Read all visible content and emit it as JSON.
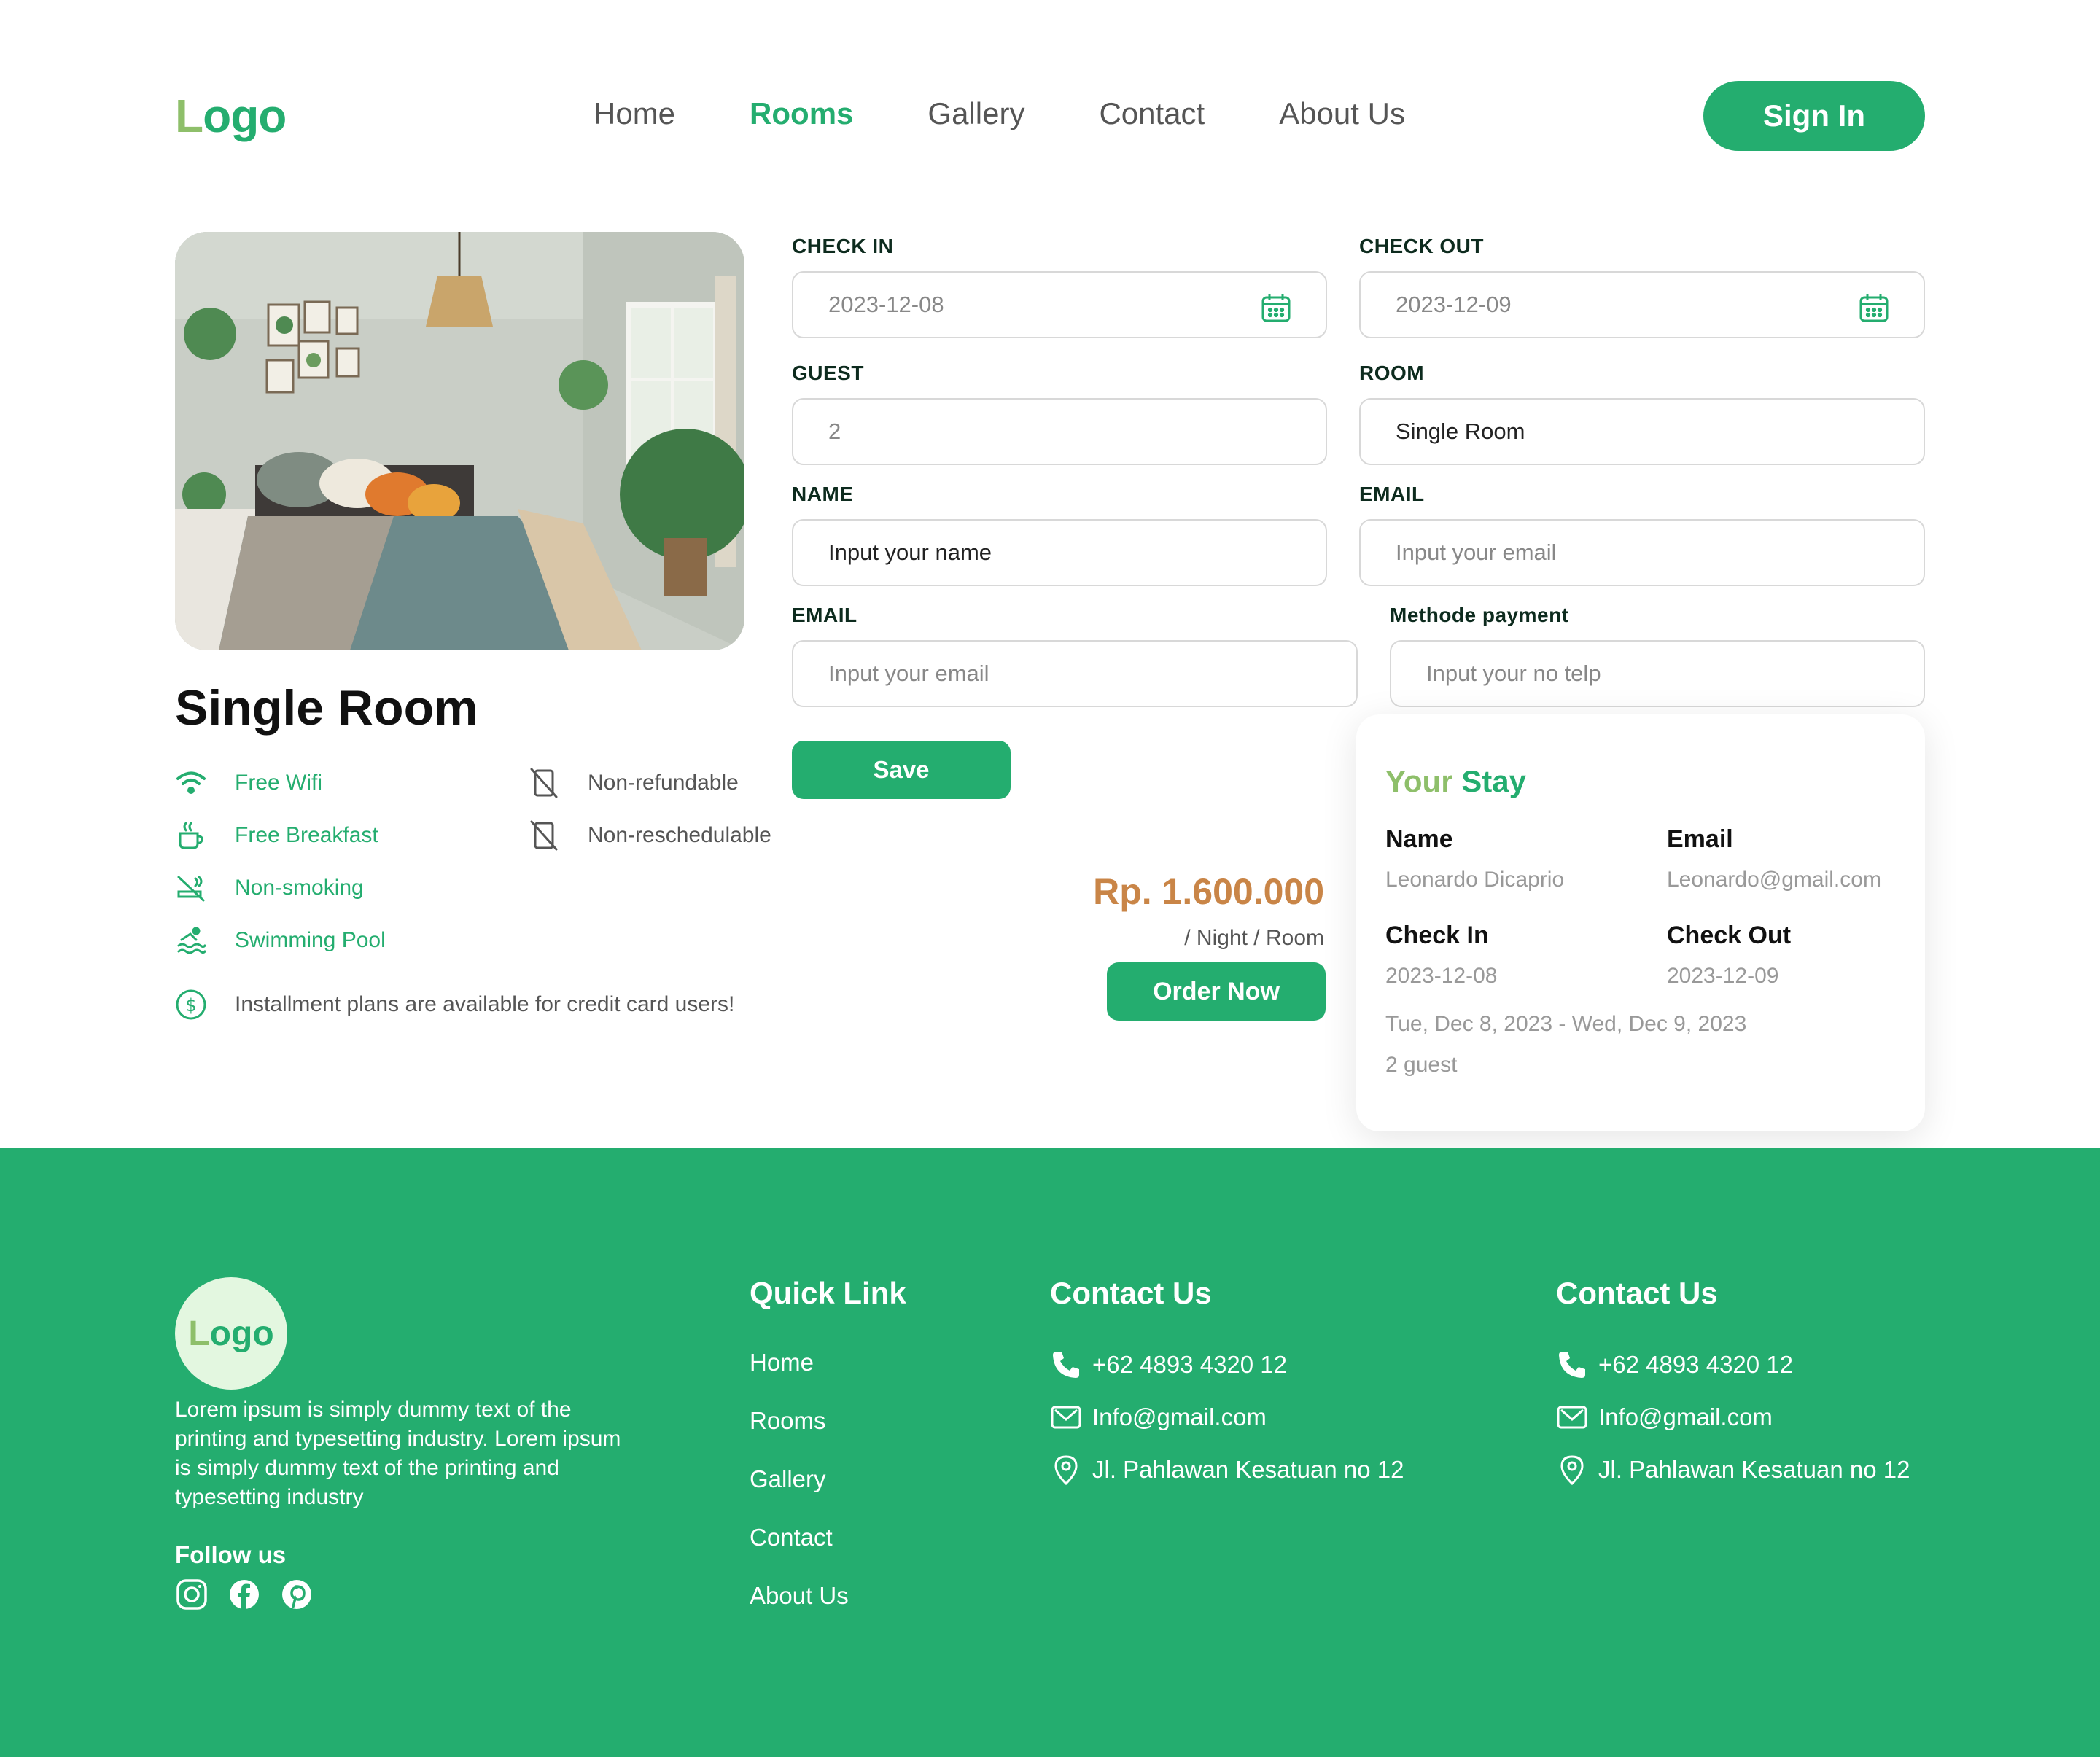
{
  "header": {
    "logo": "Logo",
    "nav": [
      "Home",
      "Rooms",
      "Gallery",
      "Contact",
      "About Us"
    ],
    "active_nav": "Rooms",
    "signin_label": "Sign In"
  },
  "room": {
    "title": "Single Room",
    "features": [
      {
        "label": "Free Wifi",
        "icon": "wifi-icon"
      },
      {
        "label": "Free Breakfast",
        "icon": "coffee-icon"
      },
      {
        "label": "Non-smoking",
        "icon": "no-smoking-icon"
      },
      {
        "label": "Swimming Pool",
        "icon": "swimming-icon"
      }
    ],
    "policies": [
      {
        "label": "Non-refundable",
        "icon": "no-phone-icon"
      },
      {
        "label": "Non-reschedulable",
        "icon": "no-phone-icon"
      }
    ],
    "installment_note": "Installment plans are available for credit card users!"
  },
  "form": {
    "checkin_label": "CHECK IN",
    "checkin_value": "2023-12-08",
    "checkout_label": "CHECK OUT",
    "checkout_value": "2023-12-09",
    "guest_label": "GUEST",
    "guest_value": "2",
    "room_label": "ROOM",
    "room_value": "Single Room",
    "name_label": "NAME",
    "name_placeholder": "Input your name",
    "email_label": "EMAIL",
    "email_placeholder": "Input your email",
    "email2_label": "EMAIL",
    "email2_placeholder": "Input your email",
    "payment_label": "Methode payment",
    "payment_placeholder": "Input your no telp",
    "save_label": "Save"
  },
  "pricing": {
    "price": "Rp. 1.600.000",
    "per": "/  Night /  Room",
    "order_label": "Order Now"
  },
  "stay": {
    "title_part1": "Your",
    "title_part2": " Stay",
    "name_label": "Name",
    "name_value": "Leonardo Dicaprio",
    "email_label": "Email",
    "email_value": "Leonardo@gmail.com",
    "checkin_label": "Check In",
    "checkin_value": "2023-12-08",
    "checkout_label": "Check Out",
    "checkout_value": "2023-12-09",
    "dates": "Tue, Dec 8, 2023 - Wed, Dec 9, 2023",
    "guests": "2 guest"
  },
  "footer": {
    "logo": "Logo",
    "description": "Lorem ipsum is simply dummy text of the printing and typesetting industry. Lorem ipsum is simply dummy text of the printing and typesetting industry",
    "follow_label": "Follow us",
    "social": [
      "instagram-icon",
      "facebook-icon",
      "pinterest-icon"
    ],
    "quick_link_title": "Quick Link",
    "quick_links": [
      "Home",
      "Rooms",
      "Gallery",
      "Contact",
      "About Us"
    ],
    "contact_title_1": "Contact Us",
    "contact_title_2": "Contact Us",
    "phone": "+62 4893 4320 12",
    "email": "Info@gmail.com",
    "address": "Jl. Pahlawan Kesatuan no 12"
  },
  "colors": {
    "accent": "#24ad6f",
    "accent_light": "#8ebf6a",
    "price": "#c98547",
    "text_dark": "#111111",
    "muted": "#999999"
  }
}
